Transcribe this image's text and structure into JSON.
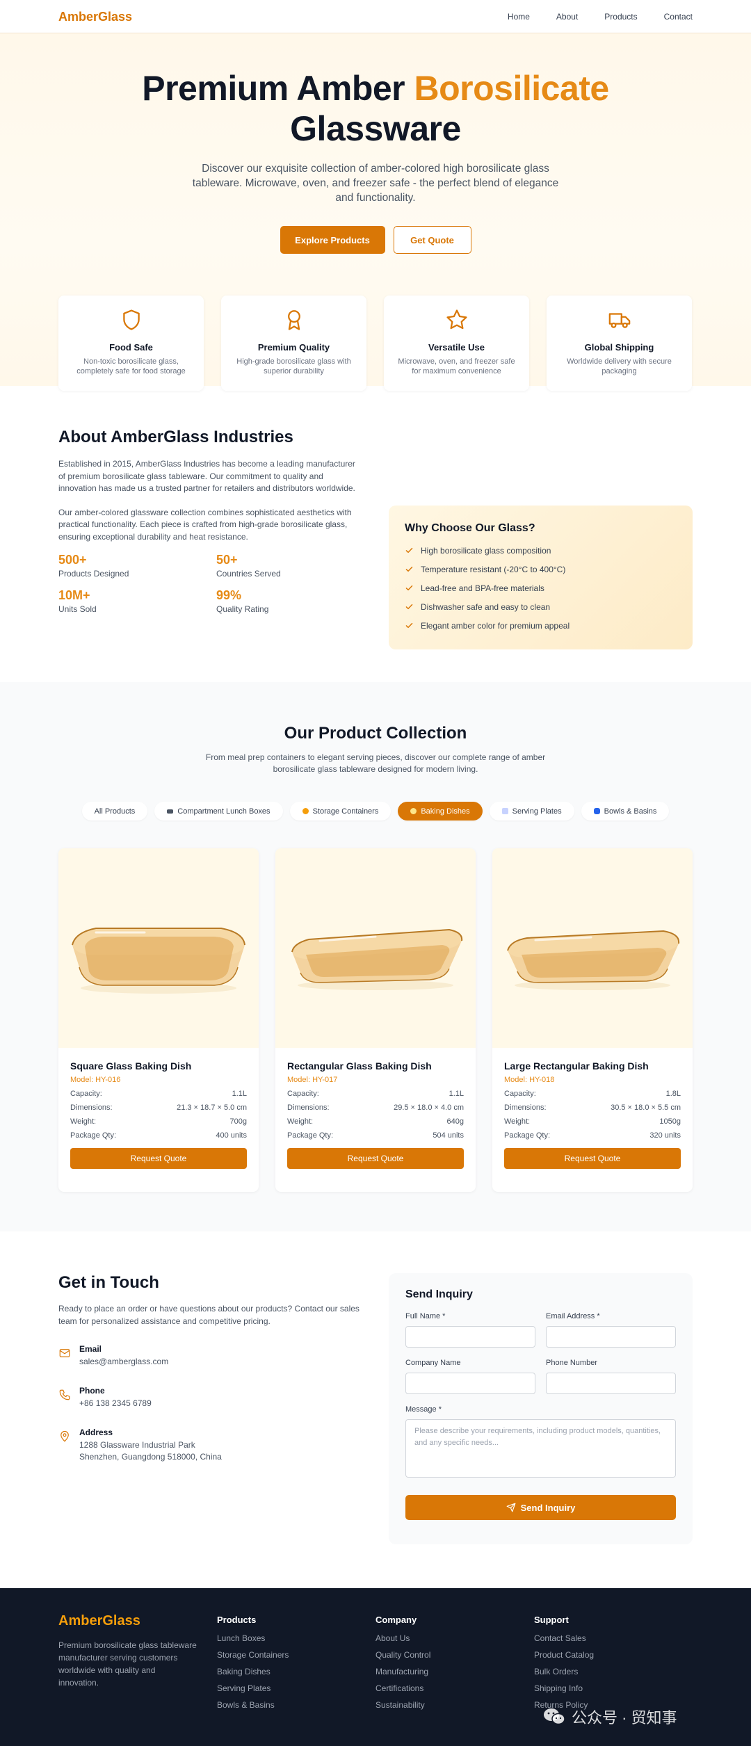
{
  "nav": {
    "brand": "AmberGlass",
    "links": [
      "Home",
      "About",
      "Products",
      "Contact"
    ]
  },
  "hero": {
    "title_part1": "Premium Amber ",
    "title_accent": "Borosilicate",
    "title_part2": " Glassware",
    "subtitle": "Discover our exquisite collection of amber-colored high borosilicate glass tableware. Microwave, oven, and freezer safe - the perfect blend of elegance and functionality.",
    "primary_button": "Explore Products",
    "secondary_button": "Get Quote",
    "features": [
      {
        "icon": "shield-icon",
        "title": "Food Safe",
        "desc": "Non-toxic borosilicate glass, completely safe for food storage"
      },
      {
        "icon": "award-icon",
        "title": "Premium Quality",
        "desc": "High-grade borosilicate glass with superior durability"
      },
      {
        "icon": "star-icon",
        "title": "Versatile Use",
        "desc": "Microwave, oven, and freezer safe for maximum convenience"
      },
      {
        "icon": "truck-icon",
        "title": "Global Shipping",
        "desc": "Worldwide delivery with secure packaging"
      }
    ]
  },
  "about": {
    "title": "About AmberGlass Industries",
    "paragraph1": "Established in 2015, AmberGlass Industries has become a leading manufacturer of premium borosilicate glass tableware. Our commitment to quality and innovation has made us a trusted partner for retailers and distributors worldwide.",
    "paragraph2": "Our amber-colored glassware collection combines sophisticated aesthetics with practical functionality. Each piece is crafted from high-grade borosilicate glass, ensuring exceptional durability and heat resistance.",
    "stats": [
      {
        "value": "500+",
        "label": "Products Designed"
      },
      {
        "value": "50+",
        "label": "Countries Served"
      },
      {
        "value": "10M+",
        "label": "Units Sold"
      },
      {
        "value": "99%",
        "label": "Quality Rating"
      }
    ],
    "why_title": "Why Choose Our Glass?",
    "why_items": [
      "High borosilicate glass composition",
      "Temperature resistant (-20°C to 400°C)",
      "Lead-free and BPA-free materials",
      "Dishwasher safe and easy to clean",
      "Elegant amber color for premium appeal"
    ]
  },
  "products": {
    "title": "Our Product Collection",
    "subtitle": "From meal prep containers to elegant serving pieces, discover our complete range of amber borosilicate glass tableware designed for modern living.",
    "filters": [
      {
        "label": "All Products",
        "active": false
      },
      {
        "label": "Compartment Lunch Boxes",
        "active": false
      },
      {
        "label": "Storage Containers",
        "active": false
      },
      {
        "label": "Baking Dishes",
        "active": true
      },
      {
        "label": "Serving Plates",
        "active": false
      },
      {
        "label": "Bowls & Basins",
        "active": false
      }
    ],
    "spec_labels": {
      "capacity": "Capacity:",
      "dimensions": "Dimensions:",
      "weight": "Weight:",
      "package": "Package Qty:"
    },
    "quote_button": "Request Quote",
    "items": [
      {
        "name": "Square Glass Baking Dish",
        "model": "Model: HY-016",
        "capacity": "1.1L",
        "dimensions": "21.3 × 18.7 × 5.0 cm",
        "weight": "700g",
        "package": "400 units"
      },
      {
        "name": "Rectangular Glass Baking Dish",
        "model": "Model: HY-017",
        "capacity": "1.1L",
        "dimensions": "29.5 × 18.0 × 4.0 cm",
        "weight": "640g",
        "package": "504 units"
      },
      {
        "name": "Large Rectangular Baking Dish",
        "model": "Model: HY-018",
        "capacity": "1.8L",
        "dimensions": "30.5 × 18.0 × 5.5 cm",
        "weight": "1050g",
        "package": "320 units"
      }
    ]
  },
  "contact": {
    "title": "Get in Touch",
    "paragraph": "Ready to place an order or have questions about our products? Contact our sales team for personalized assistance and competitive pricing.",
    "email_label": "Email",
    "email_value": "sales@amberglass.com",
    "phone_label": "Phone",
    "phone_value": "+86 138 2345 6789",
    "address_label": "Address",
    "address_line1": "1288 Glassware Industrial Park",
    "address_line2": "Shenzhen, Guangdong 518000, China",
    "form": {
      "title": "Send Inquiry",
      "full_name_label": "Full Name *",
      "email_label": "Email Address *",
      "company_label": "Company Name",
      "phone_label": "Phone Number",
      "message_label": "Message *",
      "message_placeholder": "Please describe your requirements, including product models, quantities, and any specific needs...",
      "submit": "Send Inquiry"
    }
  },
  "footer": {
    "brand": "AmberGlass",
    "description": "Premium borosilicate glass tableware manufacturer serving customers worldwide with quality and innovation.",
    "columns": [
      {
        "title": "Products",
        "links": [
          "Lunch Boxes",
          "Storage Containers",
          "Baking Dishes",
          "Serving Plates",
          "Bowls & Basins"
        ]
      },
      {
        "title": "Company",
        "links": [
          "About Us",
          "Quality Control",
          "Manufacturing",
          "Certifications",
          "Sustainability"
        ]
      },
      {
        "title": "Support",
        "links": [
          "Contact Sales",
          "Product Catalog",
          "Bulk Orders",
          "Shipping Info",
          "Returns Policy"
        ]
      }
    ]
  },
  "watermark": {
    "text": "公众号 · 贸知事"
  },
  "colors": {
    "accent": "#d97706",
    "accent_light": "#e68a16",
    "footer_bg": "#111827"
  }
}
